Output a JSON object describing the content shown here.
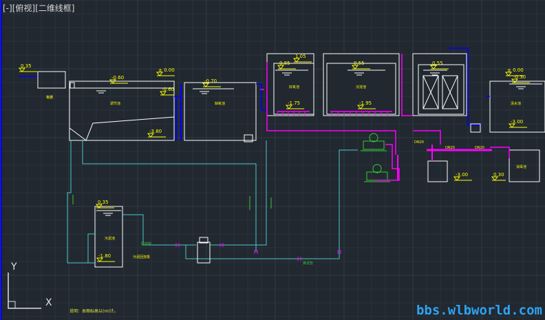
{
  "viewport_label": {
    "minus": "[-]",
    "view": "[俯视]",
    "style": "[二维线框]"
  },
  "watermark": "bbs.wlbworld.com",
  "note": "说明：本图标高以(m)计。",
  "ucs": {
    "y": "Y",
    "x": "X"
  },
  "colors": {
    "background": "#212830",
    "grid_minor": "#2a323b",
    "grid_major": "#313a44",
    "outline": "#ffffff",
    "water_pipe": "#0000ff",
    "sludge_pipe": "#ff00ff",
    "return_pipe": "#4fc9c9",
    "label": "#ffff00",
    "equipment": "#33cc33"
  },
  "elevations": {
    "inlet": "0.35",
    "grit_top": "-0.60",
    "top_000a": "± 0.00",
    "grit_side": "-0.60",
    "grit_bottom": "-3.80",
    "tank2_top": "-0.70",
    "t3_top": "1.05",
    "t3_level": "0.85",
    "t3_bottom": "-1.75",
    "t4_level": "0.55",
    "t4_bottom": "-1.95",
    "t5_level": "0.55",
    "top_000b": "± 0.00",
    "right_top": "-0.30",
    "right_bottom": "-3.00",
    "well_bottom": "-3.00",
    "box_side": "0.30",
    "sludge_top": "0.35",
    "sludge_bottom": "-1.80",
    "dn_a": "DN20",
    "dn_b": "DN20",
    "dn_c": "DN20"
  },
  "tank_labels": {
    "inlet_box": "格栅",
    "grit": "调节池",
    "tank2": "缺氧池",
    "t3": "好氧池",
    "t4": "沉淀池",
    "right": "清水池",
    "box": "消毒池",
    "sludge": "污泥池",
    "sludge_pump": "污泥回流泵",
    "pipe_a": "回流管",
    "pipe_b": "排泥管"
  }
}
